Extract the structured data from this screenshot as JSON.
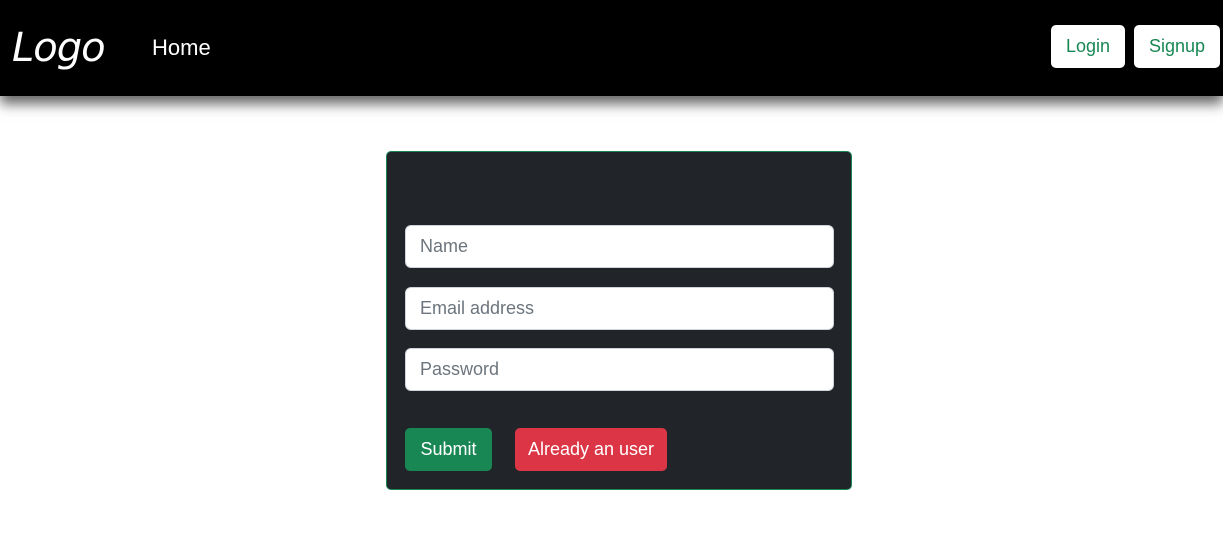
{
  "navbar": {
    "logo": "Logo",
    "home_link": "Home",
    "login_label": "Login",
    "signup_label": "Signup"
  },
  "form": {
    "name_placeholder": "Name",
    "email_placeholder": "Email address",
    "password_placeholder": "Password",
    "submit_label": "Submit",
    "already_user_label": "Already an user"
  },
  "colors": {
    "navbar_bg": "#000000",
    "card_bg": "#212529",
    "success": "#198754",
    "danger": "#dc3545"
  }
}
